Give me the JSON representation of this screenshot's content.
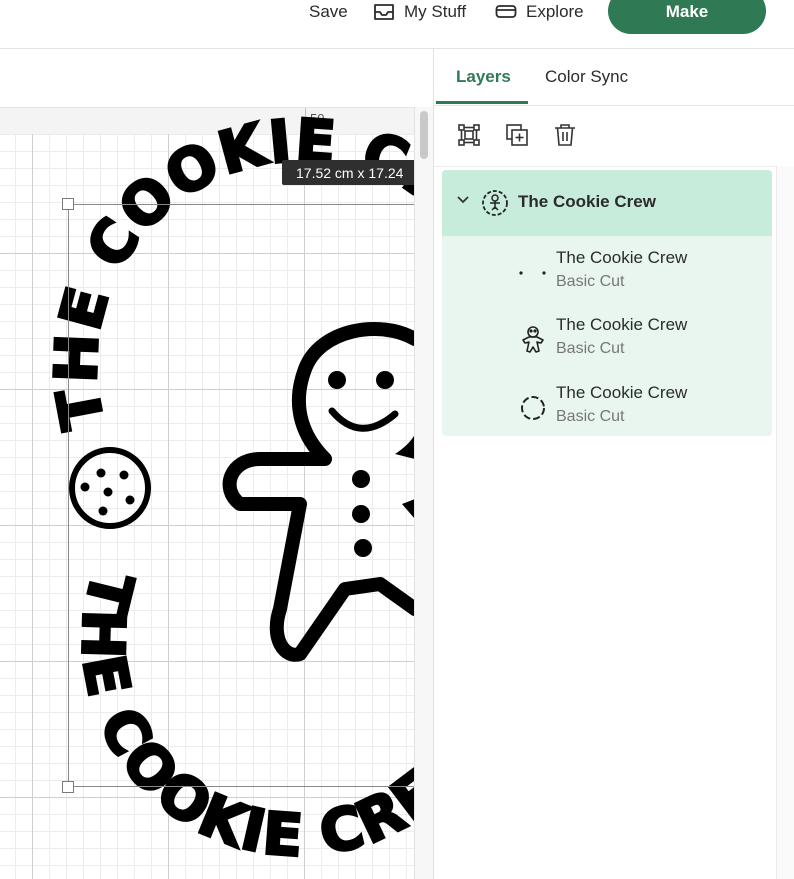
{
  "topbar": {
    "save_label": "Save",
    "mystuff_label": "My Stuff",
    "explore_label": "Explore",
    "make_label": "Make",
    "accent": "#2f7a55"
  },
  "canvas": {
    "ruler_label": "50",
    "dimensions": "17.52  cm x 17.24",
    "design_text": "THE COOKIE CREW"
  },
  "panel": {
    "tabs": [
      {
        "label": "Layers",
        "active": true
      },
      {
        "label": "Color Sync",
        "active": false
      }
    ],
    "toolbar_icons": [
      "group-icon",
      "duplicate-icon",
      "trash-icon"
    ],
    "group": {
      "title": "The Cookie Crew",
      "icon": "badge-icon",
      "layers": [
        {
          "name": "The Cookie Crew",
          "operation": "Basic Cut",
          "icon": "dots-icon"
        },
        {
          "name": "The Cookie Crew",
          "operation": "Basic Cut",
          "icon": "gingerbread-icon"
        },
        {
          "name": "The Cookie Crew",
          "operation": "Basic Cut",
          "icon": "ring-icon"
        }
      ]
    }
  }
}
